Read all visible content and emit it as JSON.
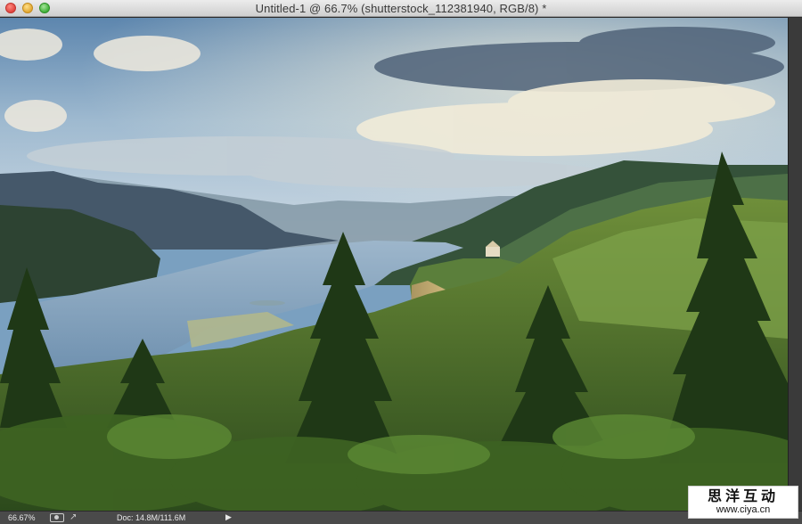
{
  "window": {
    "title": "Untitled-1 @ 66.7% (shutterstock_112381940, RGB/8) *",
    "controls": [
      "close",
      "minimize",
      "zoom"
    ]
  },
  "canvas": {
    "content": "landscape-photo"
  },
  "statusbar": {
    "zoom": "66.67%",
    "doc_info": "Doc: 14.8M/111.6M",
    "arrow": "▶"
  },
  "watermark": {
    "line1": "思洋互动",
    "line2": "www.ciya.cn"
  }
}
